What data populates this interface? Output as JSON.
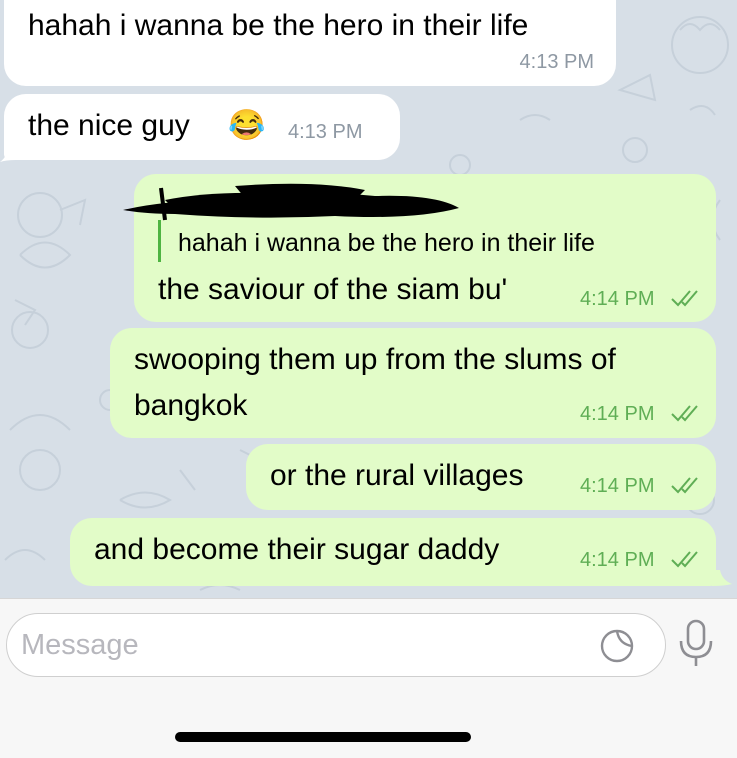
{
  "messages": [
    {
      "direction": "incoming",
      "text": "hahah i wanna be the hero in their life",
      "time": "4:13 PM"
    },
    {
      "direction": "incoming",
      "text": "the nice guy",
      "emoji": "😂",
      "time": "4:13 PM"
    },
    {
      "direction": "outgoing",
      "reply_quote": "hahah i wanna be the hero in their life",
      "reply_author_redacted": true,
      "text": "the saviour of the siam bu'",
      "time": "4:14 PM",
      "status": "read-double-check-icon"
    },
    {
      "direction": "outgoing",
      "text_lines": [
        "swooping them up from the slums of",
        "bangkok"
      ],
      "time": "4:14 PM",
      "status": "read-double-check-icon"
    },
    {
      "direction": "outgoing",
      "text": "or the rural villages",
      "time": "4:14 PM",
      "status": "read-double-check-icon"
    },
    {
      "direction": "outgoing",
      "text": "and become their sugar daddy",
      "time": "4:14 PM",
      "status": "read-double-check-icon"
    }
  ],
  "composer": {
    "placeholder": "Message",
    "sticker_icon": "sticker-icon",
    "mic_icon": "microphone-icon"
  },
  "colors": {
    "chat_background": "#d7dfe7",
    "incoming_bubble": "#ffffff",
    "outgoing_bubble": "#e2fcc8",
    "outgoing_time": "#5fae55",
    "incoming_time": "#8e98a3",
    "reply_bar": "#4eb442"
  }
}
